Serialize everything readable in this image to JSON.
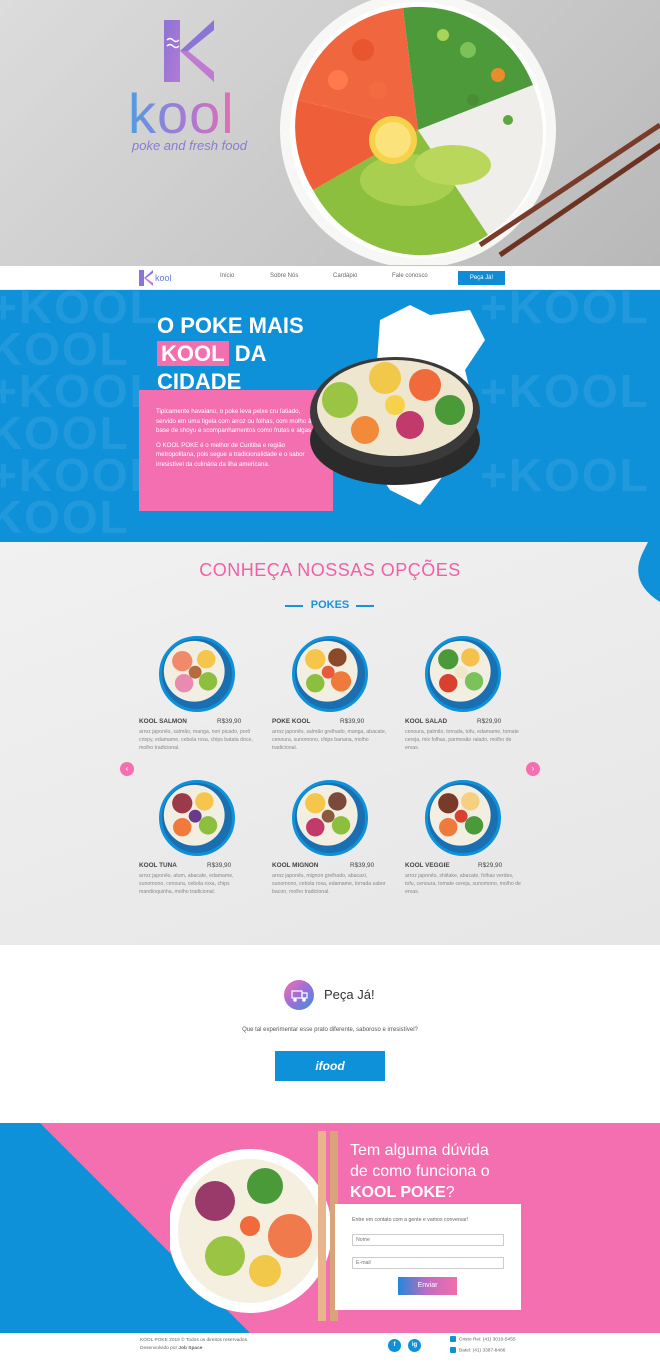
{
  "brand": {
    "name": "kool",
    "tagline": "poke and fresh food"
  },
  "nav": {
    "links": [
      "Início",
      "Sobre Nós",
      "Cardápio",
      "Fale conosco"
    ],
    "cta": "Peça Já!"
  },
  "intro": {
    "watermark": "+KOOL",
    "headline_line1": "O POKE MAIS",
    "headline_highlight": "KOOL",
    "headline_line2_rest": "DA",
    "headline_line3": "CIDADE",
    "paragraph1": "Tipicamente havaiano, o poke leva peixe cru fatiado, servido em uma tigela com arroz ou folhas, com molho à base de shoyu e scompanhamentos como frutas e algas.",
    "paragraph2": "O KOOL POKE é o melhor de Curitiba e região metropolitana, pois segue a tradicionalidade e o sabor irresistível da culinária da ilha americana."
  },
  "options": {
    "title": "CONHEÇA NOSSAS OPÇÕES",
    "subtitle": "POKES",
    "prev": "‹",
    "next": "›",
    "items": [
      {
        "name": "KOOL SALMON",
        "price": "R$39,90",
        "desc": "arroz japonês, salmão, manga, nori picado, porô crispy, edamame, cebola roxa, chips batata doce, molho tradicional."
      },
      {
        "name": "POKE KOOL",
        "price": "R$39,90",
        "desc": "arroz japonês, salmão grelhado, manga, abacate, cenoura, sunomono, chips banana, molho tradicional."
      },
      {
        "name": "KOOL SALAD",
        "price": "R$29,90",
        "desc": "cenoura, palmito, torrada, tofu, edamame, tomate cereja, mix folhas, parmesão ralado, molho de ervas."
      },
      {
        "name": "KOOL TUNA",
        "price": "R$39,90",
        "desc": "arroz japonês, atum, abacate, edamame, sunomono, cenoura, cebola roxa, chips mandioquinha, molho tradicional."
      },
      {
        "name": "KOOL MIGNON",
        "price": "R$39,90",
        "desc": "arroz japonês, mignon grelhado, abacaxi, sunomono, cebola roxa, edamame, torrada sabor bacon, molho tradicional."
      },
      {
        "name": "KOOL VEGGIE",
        "price": "R$29,90",
        "desc": "arroz japonês, shiitake, abacate, folhas verdes, tofu, cenoura, tomate cereja, sunomono, molho de ervas."
      }
    ]
  },
  "order": {
    "title": "Peça Já!",
    "text": "Que tal experimentar esse prato diferente, saboroso e irresistível?",
    "ifood": "ifood"
  },
  "contact": {
    "title_line1": "Tem alguma dúvida",
    "title_line2": "de como funciona o",
    "title_bold": "KOOL POKE",
    "title_end": "?",
    "note": "Entre em contato com a gente e vamos conversar!",
    "name_placeholder": "Nome",
    "email_placeholder": "E-mail",
    "send": "Enviar"
  },
  "footer": {
    "copyright": "KOOL POKE 2019 © Todos os direitos reservados.",
    "dev_label": "Desenvolvido por",
    "dev_name": "Job Space",
    "facebook": "f",
    "instagram": "ig",
    "phone1": "Cristo Rei: (41) 3010-5455",
    "phone2": "Batel: (41) 3387-8486"
  },
  "colors": {
    "blue": "#0f91d9",
    "pink": "#f46fb0"
  }
}
